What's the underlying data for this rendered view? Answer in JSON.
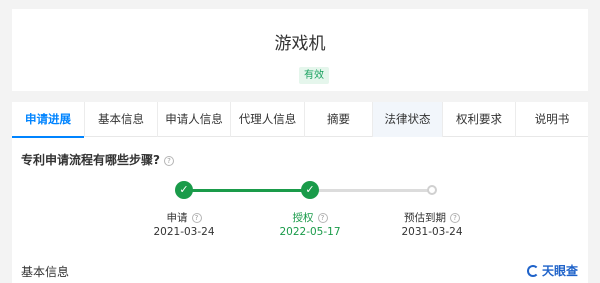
{
  "header": {
    "title": "游戏机",
    "status": "有效"
  },
  "tabs": [
    {
      "label": "申请进展",
      "active": true
    },
    {
      "label": "基本信息"
    },
    {
      "label": "申请人信息"
    },
    {
      "label": "代理人信息"
    },
    {
      "label": "摘要"
    },
    {
      "label": "法律状态",
      "highlighted": true
    },
    {
      "label": "权利要求"
    },
    {
      "label": "说明书"
    }
  ],
  "progress": {
    "question": "专利申请流程有哪些步骤?",
    "steps": [
      {
        "label": "申请",
        "date": "2021-03-24",
        "state": "done"
      },
      {
        "label": "授权",
        "date": "2022-05-17",
        "state": "current"
      },
      {
        "label": "预估到期",
        "date": "2031-03-24",
        "state": "pending"
      }
    ]
  },
  "section": {
    "title": "基本信息"
  },
  "brand": {
    "name": "天眼查"
  },
  "icons": {
    "help": "question-circle-icon",
    "check": "check-icon"
  },
  "colors": {
    "accent": "#0084ff",
    "success": "#1a9b4a",
    "brand": "#1e62c9"
  }
}
